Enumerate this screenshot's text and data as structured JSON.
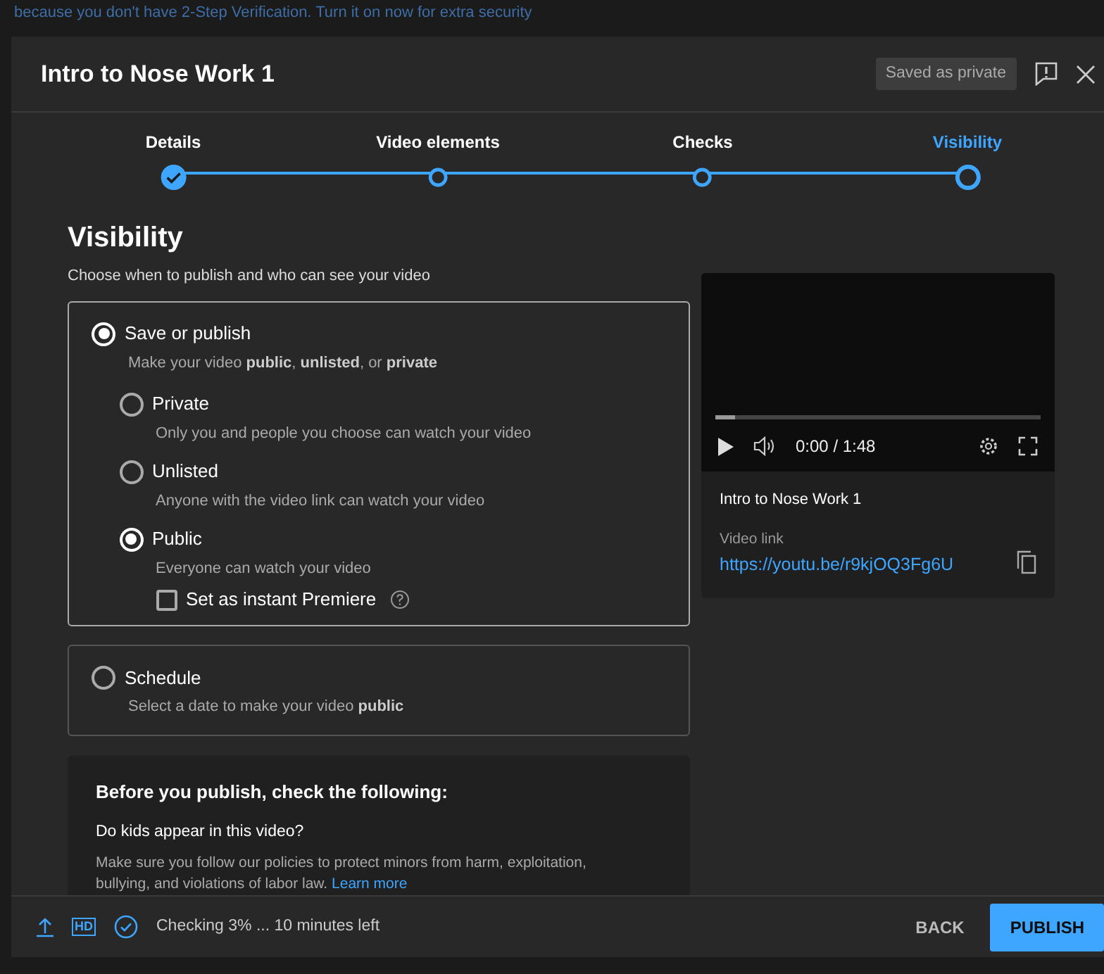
{
  "banner": {
    "text": "because you don't have 2-Step Verification. Turn it on now for extra security"
  },
  "dialog": {
    "title": "Intro to Nose Work 1",
    "save_status": "Saved as private"
  },
  "steps": [
    {
      "label": "Details",
      "done": true,
      "selected": false
    },
    {
      "label": "Video elements",
      "done": false,
      "selected": false
    },
    {
      "label": "Checks",
      "done": false,
      "selected": false
    },
    {
      "label": "Visibility",
      "done": false,
      "selected": true
    }
  ],
  "visibility": {
    "heading": "Visibility",
    "subtitle": "Choose when to publish and who can see your video",
    "save_or_publish": {
      "label": "Save or publish",
      "description": "Make your video **public**, **unlisted**, or **private**",
      "selected": true,
      "options": [
        {
          "label": "Private",
          "description": "Only you and people you choose can watch your video",
          "selected": false
        },
        {
          "label": "Unlisted",
          "description": "Anyone with the video link can watch your video",
          "selected": false
        },
        {
          "label": "Public",
          "description": "Everyone can watch your video",
          "selected": true
        }
      ],
      "premiere": {
        "label": "Set as instant Premiere",
        "checked": false
      }
    },
    "schedule": {
      "label": "Schedule",
      "description": "Select a date to make your video **public**",
      "selected": false
    },
    "checklist": {
      "title": "Before you publish, check the following:",
      "question": "Do kids appear in this video?",
      "text": "Make sure you follow our policies to protect minors from harm, exploitation, bullying, and violations of labor law.",
      "link": "Learn more"
    }
  },
  "video": {
    "progress": {
      "level": 0.06
    },
    "time": "0:00 / 1:48",
    "title": "Intro to Nose Work 1",
    "link_label": "Video link",
    "url": "https://youtu.be/r9kjOQ3Fg6U"
  },
  "footer": {
    "hd": "HD",
    "status": "Checking 3% ... 10 minutes left",
    "buttons": [
      {
        "label": "BACK",
        "kind": "text"
      },
      {
        "label": "PUBLISH",
        "kind": "primary"
      }
    ]
  }
}
